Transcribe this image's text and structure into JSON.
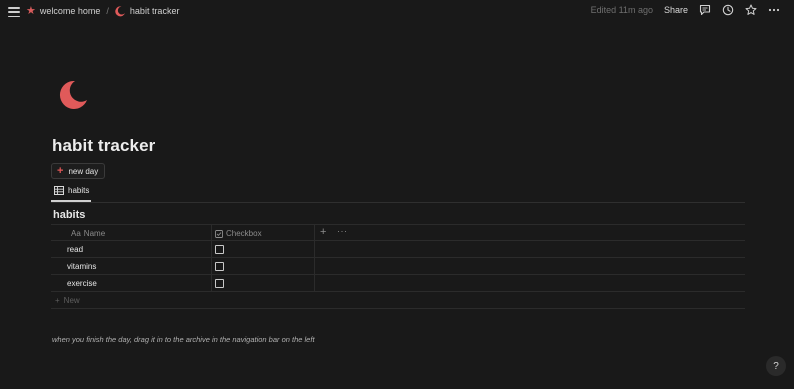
{
  "topbar": {
    "breadcrumbs": [
      {
        "label": "welcome home",
        "icon": "star-icon"
      },
      {
        "label": "habit tracker",
        "icon": "moon-icon"
      }
    ],
    "separator": "/",
    "edited": "Edited 11m ago",
    "share": "Share"
  },
  "page": {
    "title": "habit tracker",
    "icon": "crescent-moon-icon",
    "icon_color": "#e05a5a"
  },
  "new_day_button": {
    "label": "new day",
    "icon": "+"
  },
  "view_tab": {
    "label": "habits",
    "icon": "table-icon"
  },
  "database": {
    "title": "habits",
    "columns": [
      {
        "label": "Name",
        "icon": "Aa"
      },
      {
        "label": "Checkbox",
        "icon": "checkbox-icon"
      }
    ],
    "rows": [
      {
        "name": "read",
        "checked": false
      },
      {
        "name": "vitamins",
        "checked": false
      },
      {
        "name": "exercise",
        "checked": false
      }
    ],
    "new_row_label": "New",
    "add_col": "+",
    "more": "···"
  },
  "note": "when you finish the day, drag it in to the archive in the navigation bar on the left",
  "help": "?",
  "colors": {
    "background": "#191919",
    "accent": "#e05a5a"
  }
}
